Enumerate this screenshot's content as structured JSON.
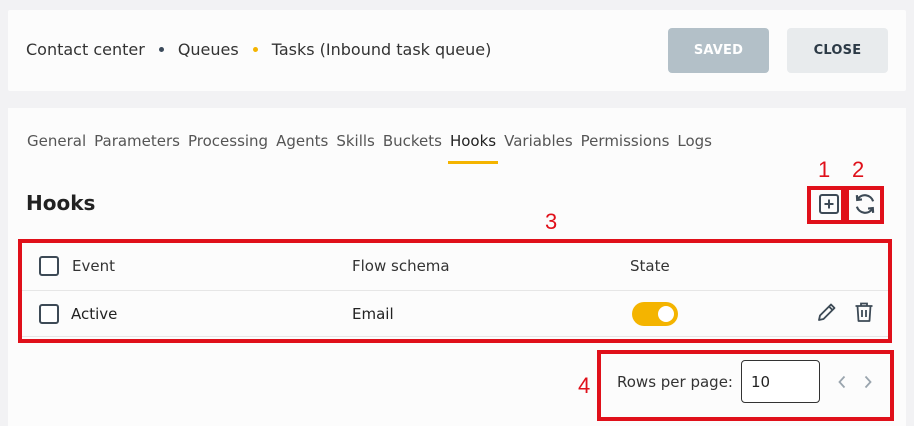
{
  "breadcrumb": {
    "items": [
      "Contact center",
      "Queues",
      "Tasks (Inbound task queue)"
    ],
    "separator_colors": [
      "#3b4a5a",
      "#f4b400"
    ]
  },
  "header_buttons": {
    "saved_label": "SAVED",
    "close_label": "CLOSE"
  },
  "tabs": [
    {
      "label": "General"
    },
    {
      "label": "Parameters"
    },
    {
      "label": "Processing"
    },
    {
      "label": "Agents"
    },
    {
      "label": "Skills"
    },
    {
      "label": "Buckets"
    },
    {
      "label": "Hooks",
      "active": true
    },
    {
      "label": "Variables"
    },
    {
      "label": "Permissions"
    },
    {
      "label": "Logs"
    }
  ],
  "section": {
    "title": "Hooks",
    "add_icon": "add-square-icon",
    "refresh_icon": "refresh-icon"
  },
  "table": {
    "columns": [
      "Event",
      "Flow schema",
      "State"
    ],
    "rows": [
      {
        "event": "Active",
        "flow_schema": "Email",
        "state": true
      }
    ]
  },
  "pagination": {
    "label": "Rows per page:",
    "value": "10"
  },
  "annotations": [
    "1",
    "2",
    "3",
    "4"
  ],
  "colors": {
    "accent": "#f4b400",
    "annotation": "#e0101a",
    "saved_bg": "#b3c0c8",
    "close_bg": "#e8ebed"
  }
}
